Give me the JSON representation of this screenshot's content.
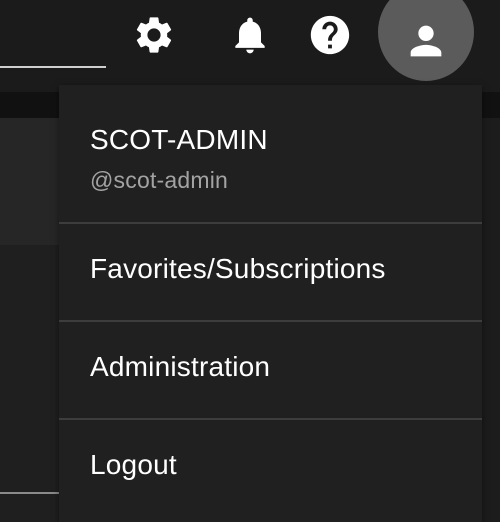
{
  "topbar": {
    "icons": {
      "settings": "gear-icon",
      "notifications": "bell-icon",
      "help": "help-icon",
      "account": "user-icon"
    }
  },
  "user_menu": {
    "user_name": "SCOT-ADMIN",
    "user_handle": "@scot-admin",
    "items": [
      {
        "label": "Favorites/Subscriptions"
      },
      {
        "label": "Administration"
      },
      {
        "label": "Logout"
      }
    ]
  },
  "colors": {
    "background": "#1c1c1c",
    "menu_background": "#202020",
    "user_button": "#5b5b5b",
    "text": "#ffffff",
    "muted_text": "#a3a3a3",
    "divider": "#3d3d3d"
  }
}
